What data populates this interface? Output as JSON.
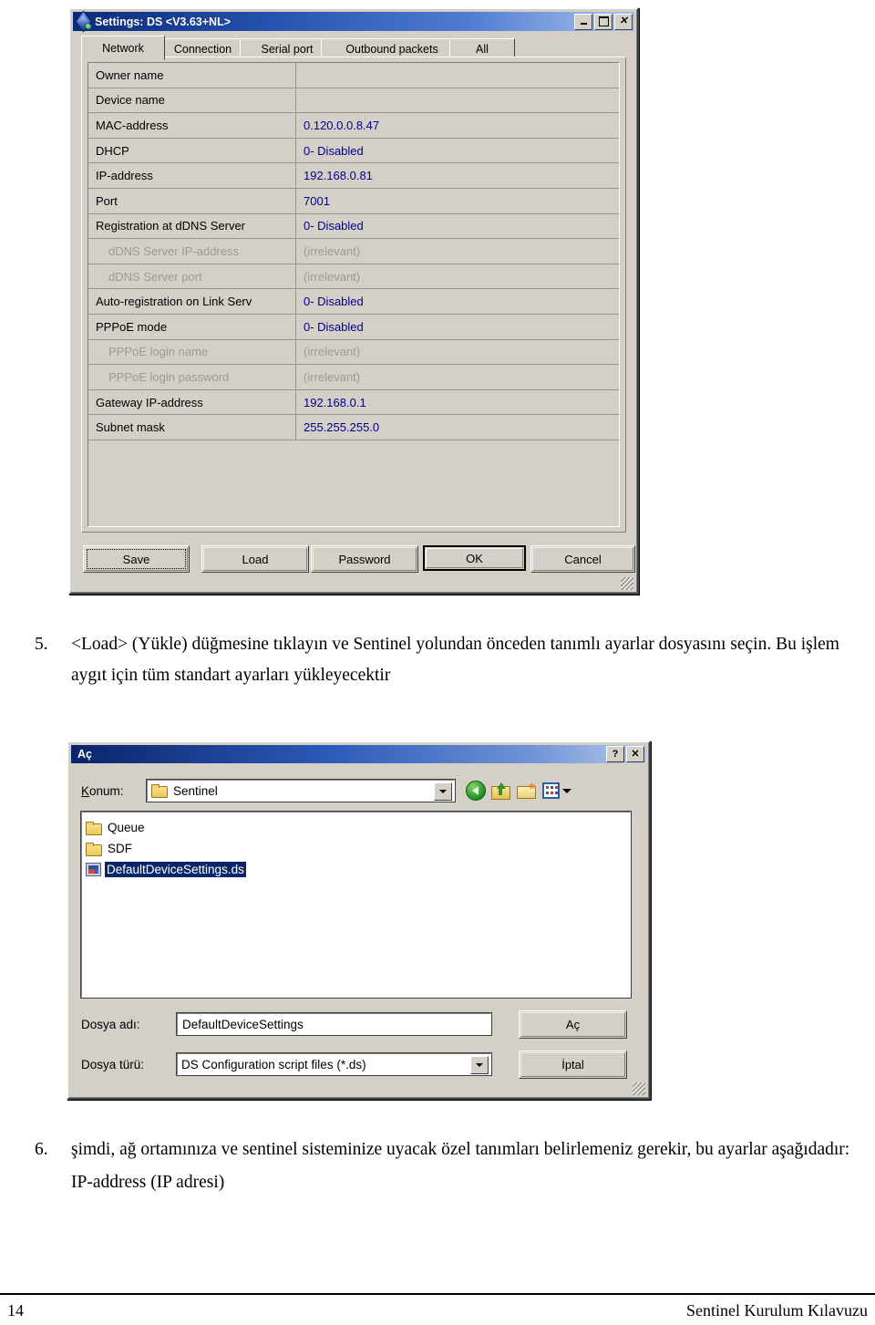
{
  "settings_window": {
    "title": "Settings: DS <V3.63+NL>",
    "app_icon": "settings-app-icon",
    "window_buttons": {
      "minimize": "_",
      "maximize": "□",
      "close": "✕"
    },
    "tabs": [
      {
        "label": "Network",
        "active": true
      },
      {
        "label": "Connection",
        "active": false
      },
      {
        "label": "Serial port",
        "active": false
      },
      {
        "label": "Outbound packets",
        "active": false
      },
      {
        "label": "All",
        "active": false
      }
    ],
    "rows": [
      {
        "label": "Owner name",
        "value": "",
        "dim": false,
        "indent": false
      },
      {
        "label": "Device name",
        "value": "",
        "dim": false,
        "indent": false
      },
      {
        "label": "MAC-address",
        "value": "0.120.0.0.8.47",
        "dim": false,
        "indent": false
      },
      {
        "label": "DHCP",
        "value": "0- Disabled",
        "dim": false,
        "indent": false
      },
      {
        "label": "IP-address",
        "value": "192.168.0.81",
        "dim": false,
        "indent": false
      },
      {
        "label": "Port",
        "value": "7001",
        "dim": false,
        "indent": false
      },
      {
        "label": "Registration at dDNS Server",
        "value": "0- Disabled",
        "dim": false,
        "indent": false
      },
      {
        "label": "dDNS Server IP-address",
        "value": "(irrelevant)",
        "dim": true,
        "indent": true
      },
      {
        "label": "dDNS Server port",
        "value": "(irrelevant)",
        "dim": true,
        "indent": true
      },
      {
        "label": "Auto-registration on Link Serv",
        "value": "0- Disabled",
        "dim": false,
        "indent": false
      },
      {
        "label": "PPPoE mode",
        "value": "0- Disabled",
        "dim": false,
        "indent": false
      },
      {
        "label": "PPPoE login name",
        "value": "(irrelevant)",
        "dim": true,
        "indent": true
      },
      {
        "label": "PPPoE login password",
        "value": "(irrelevant)",
        "dim": true,
        "indent": true
      },
      {
        "label": "Gateway IP-address",
        "value": "192.168.0.1",
        "dim": false,
        "indent": false
      },
      {
        "label": "Subnet mask",
        "value": "255.255.255.0",
        "dim": false,
        "indent": false
      }
    ],
    "buttons": {
      "save": "Save",
      "load": "Load",
      "password": "Password",
      "ok": "OK",
      "cancel": "Cancel"
    },
    "value_color": "#00008b"
  },
  "step5": {
    "number": "5.",
    "text": "<Load> (Yükle) düğmesine tıklayın ve Sentinel yolundan önceden tanımlı ayarlar dosyasını seçin. Bu işlem aygıt için tüm standart ayarları yükleyecektir"
  },
  "open_dialog": {
    "title": "Aç",
    "window_buttons": {
      "help": "?",
      "close": "✕"
    },
    "location_label": "Konum:",
    "location_label_accel": "K",
    "location_value": "Sentinel",
    "toolbar": [
      {
        "name": "back-icon",
        "tooltip": "Back"
      },
      {
        "name": "up-one-level-icon",
        "tooltip": "Up One Level"
      },
      {
        "name": "new-folder-icon",
        "tooltip": "Create New Folder"
      },
      {
        "name": "views-icon",
        "tooltip": "Views"
      }
    ],
    "files": [
      {
        "name": "Queue",
        "type": "folder",
        "selected": false
      },
      {
        "name": "SDF",
        "type": "folder",
        "selected": false
      },
      {
        "name": "DefaultDeviceSettings.ds",
        "type": "file",
        "selected": true
      }
    ],
    "filename_label": "Dosya adı:",
    "filename_value": "DefaultDeviceSettings",
    "filetype_label": "Dosya türü:",
    "filetype_value": "DS Configuration script files (*.ds)",
    "open_button": "Aç",
    "cancel_button": "İptal"
  },
  "step6": {
    "number": "6.",
    "text": "şimdi, ağ ortamınıza ve sentinel sisteminize uyacak özel tanımları belirlemeniz gerekir, bu ayarlar aşağıdadır:",
    "sub_text": "IP-address (IP adresi)"
  },
  "footer": {
    "page_number": "14",
    "document_title": "Sentinel Kurulum Kılavuzu"
  }
}
